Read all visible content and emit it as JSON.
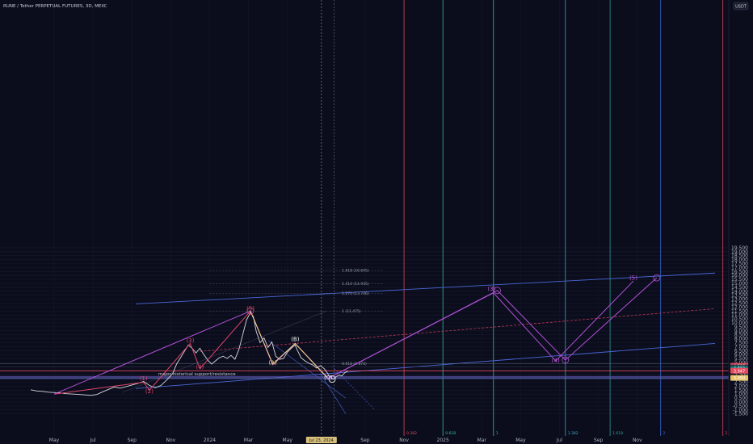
{
  "header": {
    "title": "RUNE / Tether PERPETUAL FUTURES, 3D, MEXC",
    "currency": "USDT"
  },
  "chart_data": {
    "type": "line",
    "ylim": [
      -1.5,
      20
    ],
    "y_ticks": [
      {
        "label": "19.500",
        "v": 19.5
      },
      {
        "label": "19.000",
        "v": 19.0
      },
      {
        "label": "18.500",
        "v": 18.5
      },
      {
        "label": "18.000",
        "v": 18.0
      },
      {
        "label": "17.500",
        "v": 17.5
      },
      {
        "label": "17.000",
        "v": 17.0
      },
      {
        "label": "16.500",
        "v": 16.5
      },
      {
        "label": "16.000",
        "v": 16.0
      },
      {
        "label": "15.500",
        "v": 15.5
      },
      {
        "label": "15.000",
        "v": 15.0
      },
      {
        "label": "14.500",
        "v": 14.5
      },
      {
        "label": "14.000",
        "v": 14.0
      },
      {
        "label": "13.500",
        "v": 13.5
      },
      {
        "label": "13.000",
        "v": 13.0
      },
      {
        "label": "12.500",
        "v": 12.5
      },
      {
        "label": "12.000",
        "v": 12.0
      },
      {
        "label": "11.500",
        "v": 11.5
      },
      {
        "label": "11.000",
        "v": 11.0
      },
      {
        "label": "10.500",
        "v": 10.5
      },
      {
        "label": "10.000",
        "v": 10.0
      },
      {
        "label": "9.500",
        "v": 9.5
      },
      {
        "label": "9.000",
        "v": 9.0
      },
      {
        "label": "8.500",
        "v": 8.5
      },
      {
        "label": "8.000",
        "v": 8.0
      },
      {
        "label": "7.500",
        "v": 7.5
      },
      {
        "label": "7.000",
        "v": 7.0
      },
      {
        "label": "6.500",
        "v": 6.5
      },
      {
        "label": "6.000",
        "v": 6.0
      },
      {
        "label": "5.500",
        "v": 5.5
      },
      {
        "label": "5.000",
        "v": 5.0
      },
      {
        "label": "3.500",
        "v": 3.5
      },
      {
        "label": "2.500",
        "v": 2.5
      },
      {
        "label": "2.000",
        "v": 2.0
      },
      {
        "label": "1.500",
        "v": 1.5
      },
      {
        "label": "1.000",
        "v": 1.0
      },
      {
        "label": "0.500",
        "v": 0.5
      },
      {
        "label": "0.000",
        "v": 0.0
      },
      {
        "label": "-0.500",
        "v": -0.5
      },
      {
        "label": "-1.000",
        "v": -1.0
      },
      {
        "label": "-1.500",
        "v": -1.5
      }
    ],
    "x_ticks": [
      {
        "label": "May",
        "t": 0
      },
      {
        "label": "Jul",
        "t": 2
      },
      {
        "label": "Sep",
        "t": 4
      },
      {
        "label": "Nov",
        "t": 6
      },
      {
        "label": "2024",
        "t": 8
      },
      {
        "label": "Mar",
        "t": 10
      },
      {
        "label": "May",
        "t": 12
      },
      {
        "label": "Sep",
        "t": 16
      },
      {
        "label": "Nov",
        "t": 18
      },
      {
        "label": "2025",
        "t": 20
      },
      {
        "label": "Mar",
        "t": 22
      },
      {
        "label": "May",
        "t": 24
      },
      {
        "label": "Jul",
        "t": 26
      },
      {
        "label": "Sep",
        "t": 28
      },
      {
        "label": "Nov",
        "t": 30
      }
    ],
    "x_range": [
      -1.2,
      32.5
    ],
    "current_date_label": "Jul 23, 2024",
    "price_series": [
      [
        -1.2,
        1.55
      ],
      [
        -0.9,
        1.4
      ],
      [
        -0.6,
        1.35
      ],
      [
        -0.3,
        1.25
      ],
      [
        0,
        1.2
      ],
      [
        0.3,
        1.15
      ],
      [
        0.6,
        1.05
      ],
      [
        1,
        1.0
      ],
      [
        1.3,
        0.95
      ],
      [
        1.6,
        0.9
      ],
      [
        1.9,
        0.85
      ],
      [
        2.2,
        0.95
      ],
      [
        2.5,
        1.3
      ],
      [
        2.8,
        1.6
      ],
      [
        3.1,
        1.9
      ],
      [
        3.4,
        1.75
      ],
      [
        3.7,
        1.95
      ],
      [
        4.0,
        2.15
      ],
      [
        4.3,
        2.35
      ],
      [
        4.6,
        2.6
      ],
      [
        4.9,
        2.1
      ],
      [
        5.2,
        1.8
      ],
      [
        5.5,
        2.1
      ],
      [
        5.8,
        2.8
      ],
      [
        6.1,
        3.6
      ],
      [
        6.3,
        4.8
      ],
      [
        6.5,
        5.6
      ],
      [
        6.7,
        6.4
      ],
      [
        6.9,
        7.2
      ],
      [
        7.1,
        6.8
      ],
      [
        7.3,
        6.2
      ],
      [
        7.5,
        6.8
      ],
      [
        7.7,
        6.0
      ],
      [
        7.9,
        5.3
      ],
      [
        8.1,
        4.8
      ],
      [
        8.3,
        5.2
      ],
      [
        8.5,
        5.6
      ],
      [
        8.7,
        5.8
      ],
      [
        8.9,
        5.5
      ],
      [
        9.1,
        5.9
      ],
      [
        9.3,
        5.4
      ],
      [
        9.5,
        6.6
      ],
      [
        9.7,
        8.5
      ],
      [
        9.9,
        10.4
      ],
      [
        10.1,
        11.3
      ],
      [
        10.25,
        10.8
      ],
      [
        10.4,
        8.9
      ],
      [
        10.6,
        7.5
      ],
      [
        10.8,
        8.1
      ],
      [
        11.0,
        6.9
      ],
      [
        11.2,
        7.6
      ],
      [
        11.4,
        5.8
      ],
      [
        11.6,
        5.4
      ],
      [
        11.8,
        5.5
      ],
      [
        12.0,
        6.3
      ],
      [
        12.2,
        6.8
      ],
      [
        12.4,
        7.2
      ],
      [
        12.5,
        6.6
      ],
      [
        12.7,
        5.6
      ],
      [
        12.9,
        5.2
      ],
      [
        13.1,
        4.9
      ],
      [
        13.3,
        4.7
      ],
      [
        13.5,
        4.3
      ],
      [
        13.7,
        4.6
      ],
      [
        13.9,
        4.2
      ],
      [
        14.05,
        3.7
      ],
      [
        14.2,
        3.1
      ],
      [
        14.35,
        2.85
      ],
      [
        14.5,
        3.2
      ],
      [
        14.65,
        3.4
      ],
      [
        14.8,
        3.3
      ],
      [
        14.95,
        3.7
      ],
      [
        15.1,
        3.9
      ]
    ],
    "major_support_label": "major historical support/resistance",
    "fib_labels": [
      {
        "label": "1.618 (16.645)",
        "v": 16.64
      },
      {
        "label": "1.414 (14.935)",
        "v": 14.94
      },
      {
        "label": "1.272 (13.746)",
        "v": 13.75
      },
      {
        "label": "1 (11.475)",
        "v": 11.48
      },
      {
        "label": "0.618 (4.874)",
        "v": 4.87
      }
    ],
    "time_fibs": [
      {
        "label": "0.382",
        "t": 18.0,
        "color": "#e24a5e"
      },
      {
        "label": "0.618",
        "t": 20.0,
        "color": "#3fbfa0"
      },
      {
        "label": "1",
        "t": 22.6,
        "color": "#3fbfa0"
      },
      {
        "label": "1.382",
        "t": 26.3,
        "color": "#3fa6c8"
      },
      {
        "label": "1.618",
        "t": 28.6,
        "color": "#2fa39a"
      },
      {
        "label": "2",
        "t": 31.2,
        "color": "#3a6bd6"
      },
      {
        "label": "2.382",
        "t": 34.4,
        "color": "#e24a5e"
      }
    ],
    "wave_labels": [
      {
        "label": "(1)",
        "t": 4.6,
        "v": 2.75,
        "color": "#e0456a"
      },
      {
        "label": "(2)",
        "t": 4.9,
        "v": 1.1,
        "color": "#e0456a"
      },
      {
        "label": "(3)",
        "t": 7.0,
        "v": 7.55,
        "color": "#e0456a"
      },
      {
        "label": "(4)",
        "t": 7.5,
        "v": 4.2,
        "color": "#e0456a"
      },
      {
        "label": "(5)",
        "t": 10.1,
        "v": 11.6,
        "color": "#e0456a"
      },
      {
        "label": "(A)",
        "t": 11.25,
        "v": 4.75,
        "color": "#f0d98a"
      },
      {
        "label": "(B)",
        "t": 12.4,
        "v": 7.7,
        "color": "#ffffff"
      },
      {
        "label": "(C)",
        "t": 14.1,
        "v": 2.85,
        "color": "#ffffff"
      },
      {
        "label": "(3)",
        "t": 22.5,
        "v": 14.08,
        "color": "#c05ad8"
      },
      {
        "label": "(4)",
        "t": 25.8,
        "v": 5.0,
        "color": "#c05ad8"
      },
      {
        "label": "(5)",
        "t": 29.8,
        "v": 15.45,
        "color": "#c05ad8"
      }
    ],
    "price_tags": [
      {
        "label": "4.506",
        "v": 4.58,
        "color": "#e24a5e"
      },
      {
        "label": "4.389",
        "v": 4.38,
        "color": "#2b2f3f"
      },
      {
        "label": "4.294",
        "v": 4.17,
        "color": "#0e7c7b"
      },
      {
        "label": "3.947",
        "v": 3.95,
        "color": "#e24a5e"
      },
      {
        "label": "3.050",
        "v": 3.05,
        "color": "#e7c36a"
      }
    ]
  }
}
